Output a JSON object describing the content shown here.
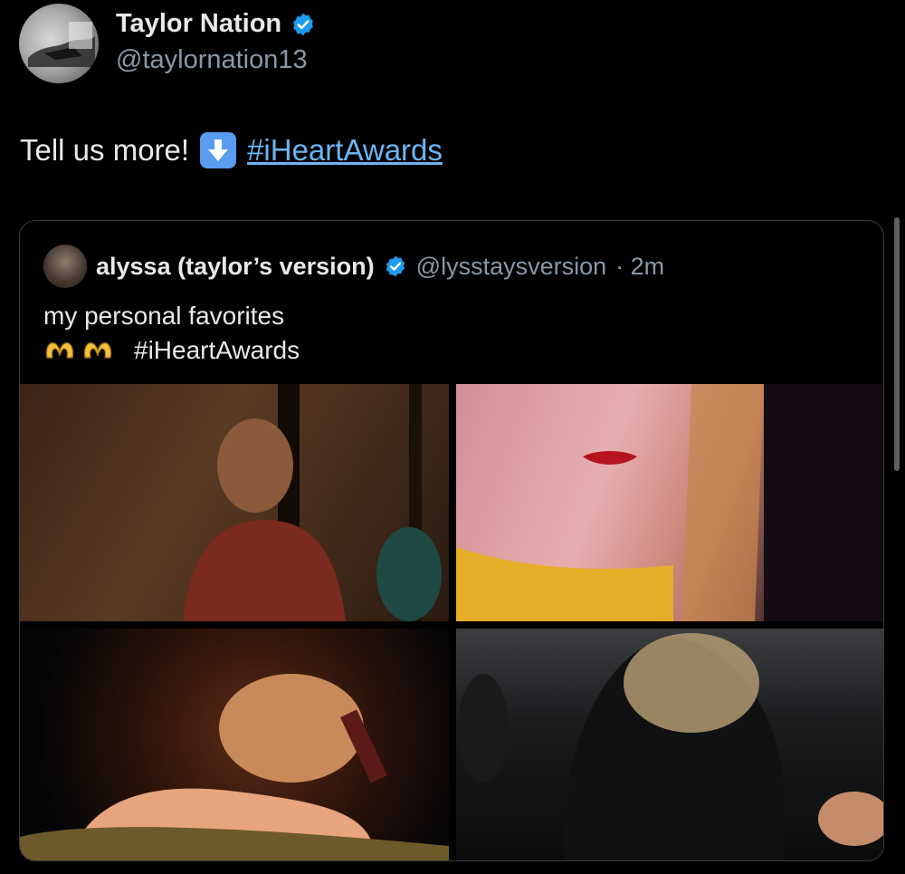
{
  "tweet": {
    "author_name": "Taylor Nation",
    "author_handle": "@taylornation13",
    "text": "Tell us more!",
    "hashtag": "#iHeartAwards"
  },
  "quote": {
    "author_name": "alyssa (taylor’s version)",
    "author_handle": "@lysstaysversion",
    "time": "· 2m",
    "line1": "my personal favorites",
    "hashtag": "#iHeartAwards"
  },
  "icons": {
    "verified": "verified-badge-icon",
    "arrow": "down-arrow-emoji",
    "hearthands": "heart-hands-emoji"
  },
  "colors": {
    "link": "#6cb5f4",
    "verified": "#1d9bf0",
    "muted": "#8b98a5"
  }
}
